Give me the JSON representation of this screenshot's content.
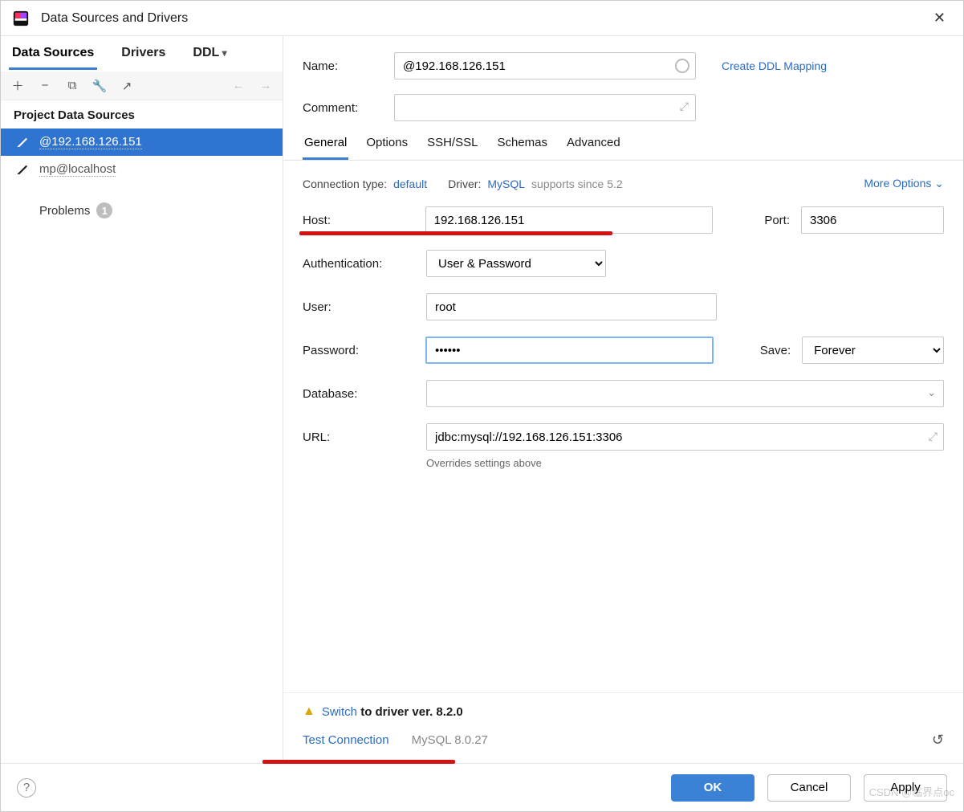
{
  "window": {
    "title": "Data Sources and Drivers"
  },
  "leftTabs": {
    "t1": "Data Sources",
    "t2": "Drivers",
    "t3": "DDL"
  },
  "sectionHeader": "Project Data Sources",
  "dataSources": [
    {
      "label": "@192.168.126.151",
      "selected": true
    },
    {
      "label": "mp@localhost",
      "selected": false
    }
  ],
  "problems": {
    "label": "Problems",
    "count": "1"
  },
  "form": {
    "nameLabel": "Name:",
    "nameValue": "@192.168.126.151",
    "createDdl": "Create DDL Mapping",
    "commentLabel": "Comment:"
  },
  "innerTabs": {
    "general": "General",
    "options": "Options",
    "sshssl": "SSH/SSL",
    "schemas": "Schemas",
    "advanced": "Advanced"
  },
  "conn": {
    "typeLabel": "Connection type:",
    "typeValue": "default",
    "driverLabel": "Driver:",
    "driverValue": "MySQL",
    "supports": "supports since 5.2",
    "more": "More Options"
  },
  "fields": {
    "hostLabel": "Host:",
    "hostValue": "192.168.126.151",
    "portLabel": "Port:",
    "portValue": "3306",
    "authLabel": "Authentication:",
    "authValue": "User & Password",
    "userLabel": "User:",
    "userValue": "root",
    "pwdLabel": "Password:",
    "pwdValue": "••••••",
    "saveLabel": "Save:",
    "saveValue": "Forever",
    "dbLabel": "Database:",
    "dbValue": "",
    "urlLabel": "URL:",
    "urlValue": "jdbc:mysql://192.168.126.151:3306",
    "overrides": "Overrides settings above"
  },
  "footer": {
    "switchLink": "Switch",
    "switchRest": " to driver ver. 8.2.0",
    "test": "Test Connection",
    "ver": "MySQL 8.0.27"
  },
  "buttons": {
    "ok": "OK",
    "cancel": "Cancel",
    "apply": "Apply"
  },
  "watermark": "CSDN @临界点oc"
}
